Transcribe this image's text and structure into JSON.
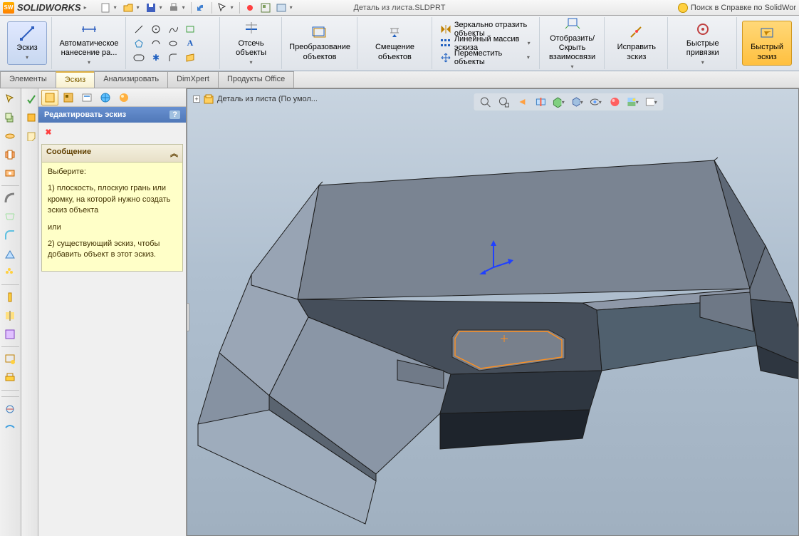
{
  "app": {
    "name_part1": "SOLID",
    "name_part2": "WORKS"
  },
  "doc_title": "Деталь из листа.SLDPRT",
  "help_search": "Поиск в Справке по SolidWor",
  "ribbon": {
    "sketch": "Эскиз",
    "auto_dim": "Автоматическое нанесение ра...",
    "trim": "Отсечь объекты",
    "convert": "Преобразование объектов",
    "offset": "Смещение объектов",
    "mirror": "Зеркально отразить объекты",
    "linear": "Линейный массив эскиза",
    "move": "Переместить объекты",
    "show_hide": "Отобразить/Скрыть взаимосвязи",
    "repair": "Исправить эскиз",
    "quick_snaps": "Быстрые привязки",
    "rapid_sketch": "Быстрый эскиз"
  },
  "tabs": {
    "t1": "Элементы",
    "t2": "Эскиз",
    "t3": "Анализировать",
    "t4": "DimXpert",
    "t5": "Продукты Office"
  },
  "breadcrumb": "Деталь из листа  (По умол...",
  "prop": {
    "title": "Редактировать эскиз",
    "help": "?",
    "msg_head": "Сообщение",
    "msg_arrow": "︽",
    "msg1": "Выберите:",
    "msg2": "1) плоскость, плоскую грань или кромку, на которой нужно создать эскиз объекта",
    "msg3": "или",
    "msg4": "2) существующий эскиз, чтобы добавить объект в этот эскиз."
  }
}
